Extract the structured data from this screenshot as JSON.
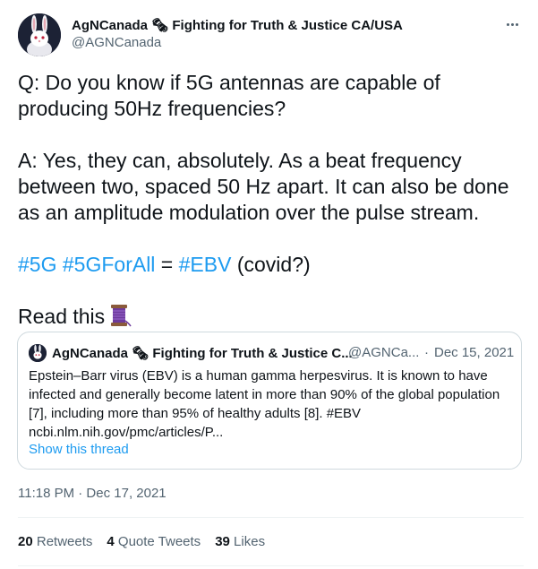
{
  "author": {
    "display_name": "AgNCanada 🗞 Fighting for Truth & Justice CA/USA",
    "handle": "@AGNCanada",
    "avatar_icon": "white-rabbit-avatar"
  },
  "tweet": {
    "line1": "Q: Do you know if 5G antennas are capable of",
    "line2": "producing 50Hz frequencies?",
    "line3": "A: Yes, they can, absolutely. As a beat frequency",
    "line4": "between two, spaced 50 Hz apart. It can also be done",
    "line5": "as an amplitude modulation over the pulse stream.",
    "hashtag1": "#5G",
    "hashtag2": "#5GForAll",
    "equals": " = ",
    "hashtag3": "#EBV",
    "tail": " (covid?)",
    "read_this": "Read this",
    "emoji_icon": "thread-spool-icon"
  },
  "quote": {
    "display_name": "AgNCanada 🗞 Fighting for Truth & Justice C...",
    "handle": "@AGNCa...",
    "dot": "·",
    "date": "Dec 15, 2021",
    "line1": "Epstein–Barr virus (EBV) is a human gamma herpesvirus. It is known to have",
    "line2": "infected and generally become latent in more than 90% of the global population",
    "line3": "[7], including more than 95% of healthy adults [8]. #EBV",
    "line4": "ncbi.nlm.nih.gov/pmc/articles/P...",
    "show_thread": "Show this thread"
  },
  "timestamp": "11:18 PM · Dec 17, 2021",
  "stats": {
    "retweets_count": "20",
    "retweets_label": "Retweets",
    "quotes_count": "4",
    "quotes_label": "Quote Tweets",
    "likes_count": "39",
    "likes_label": "Likes"
  },
  "colors": {
    "link": "#1d9bf0",
    "secondary_text": "#536471",
    "primary_text": "#0f1419",
    "border": "#cfd9de"
  }
}
